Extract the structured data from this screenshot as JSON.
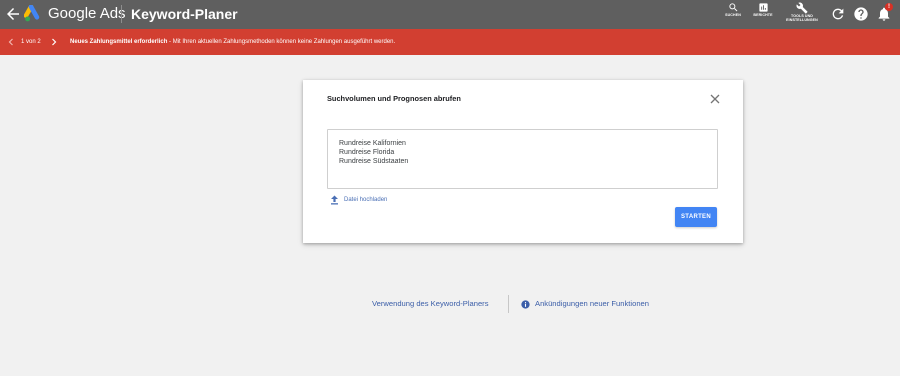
{
  "app": {
    "brand": "Google Ads",
    "page_title": "Keyword-Planer"
  },
  "topbar": {
    "tools": [
      {
        "label": "SUCHEN",
        "icon": "search-icon"
      },
      {
        "label": "BERICHTE",
        "icon": "reports-icon"
      },
      {
        "label": "TOOLS UND EINSTELLUNGEN",
        "icon": "wrench-icon"
      }
    ],
    "notification_badge": "!"
  },
  "banner": {
    "pager": "1 von 2",
    "title": "Neues Zahlungsmittel erforderlich",
    "message": " - Mit Ihren aktuellen Zahlungsmethoden können keine Zahlungen ausgeführt werden.",
    "color": "#d23f31"
  },
  "dialog": {
    "title": "Suchvolumen und Prognosen abrufen",
    "keywords": [
      "Rundreise Kalifornien",
      "Rundreise Florida",
      "Rundreise Südstaaten"
    ],
    "upload_label": "Datei hochladen",
    "start_button": "STARTEN"
  },
  "footer": {
    "usage_link": "Verwendung des Keyword-Planers",
    "announcements_link": "Ankündigungen neuer Funktionen"
  },
  "colors": {
    "topbar": "#5f5f5f",
    "accent": "#4285f4",
    "link": "#3b5ea8"
  }
}
